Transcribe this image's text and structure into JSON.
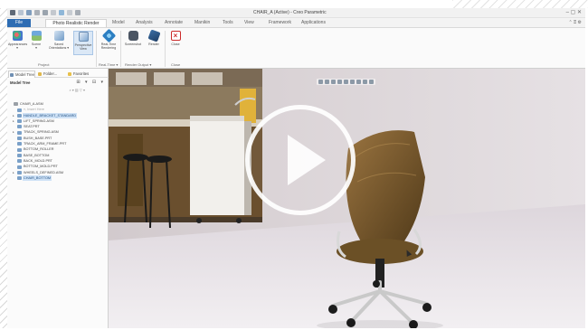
{
  "window": {
    "title": "CHAIR_A (Active) - Creo Parametric",
    "controls": "– ▢ ✕",
    "quick_access_icons": [
      "new-icon",
      "open-icon",
      "save-icon",
      "undo-icon",
      "redo-icon",
      "regenerate-icon",
      "windows-icon",
      "close-window-icon",
      "customize-icon"
    ]
  },
  "ribbon": {
    "tabs": {
      "file": "File",
      "active": "Photo Realistic Render",
      "model": "Model",
      "analysis": "Analysis",
      "annotate": "Annotate",
      "manikin": "Manikin",
      "tools": "Tools",
      "view": "View",
      "framework": "Framework",
      "applications": "Applications"
    },
    "right_tools": "⌃ ⍰ ⚙",
    "buttons": {
      "appearances": "Appearances\n▾",
      "scene": "Scene\n▾",
      "saved_orientations": "Saved\nOrientations ▾",
      "perspective_view": "Perspective\nView",
      "real_time_rendering": "Real-Time\nRendering",
      "screenshot": "Screenshot",
      "render": "Render",
      "close": "Close"
    },
    "groups": {
      "project": "Project",
      "real_time": "Real-Time ▾",
      "render_output": "Render Output ▾",
      "close": "Close"
    },
    "colors": {
      "file_tab": "#2d6cb3",
      "selected_button": "#dbe8f6"
    }
  },
  "panel": {
    "tabs": {
      "model_tree": "Model Tree",
      "folder_browser": "Folder...",
      "favorites": "Favorites"
    },
    "title": "Model Tree",
    "tool_icons": "⊞ ▾ ⊟ ▾",
    "search_placeholder": "⌕ ▾ ▨ ▽ ▾",
    "tree": [
      {
        "label": "CHAIR_A.ASM",
        "root": true,
        "level": 0
      },
      {
        "label": "», Insert Here",
        "dim": true,
        "level": 1
      },
      {
        "label": "HANDLE_BRACKET_STANDARD",
        "highlight": true,
        "level": 1,
        "expand": "▸"
      },
      {
        "label": "LIFT_SPRING.ASM",
        "level": 1,
        "expand": "▸"
      },
      {
        "label": "SEAT.PRT",
        "level": 1
      },
      {
        "label": "TRACK_SPRING.ASM",
        "level": 1,
        "expand": "▸"
      },
      {
        "label": "BUSH_BASE.PRT",
        "level": 1
      },
      {
        "label": "TRACK_ARM_FRAME.PRT",
        "level": 1
      },
      {
        "label": "BOTTOM_ROLLER",
        "level": 1
      },
      {
        "label": "BASE_BOTTOM",
        "level": 1
      },
      {
        "label": "BACK_MOLD.PRT",
        "level": 1
      },
      {
        "label": "BOTTOM_MOLD.PRT",
        "level": 1
      },
      {
        "label": "WHEELS_DEFINED.ASM",
        "level": 1,
        "expand": "▸"
      },
      {
        "label": "CHAIR_BOTTOM",
        "highlight": true,
        "level": 1
      }
    ]
  },
  "viewport": {
    "toolbar_icons": [
      "refit-icon",
      "zoom-in-icon",
      "zoom-out-icon",
      "repaint-icon",
      "display-style-icon",
      "saved-views-icon",
      "datum-display-icon",
      "spin-center-icon",
      "annotation-display-icon"
    ],
    "play_button_icon": "play-icon",
    "colors": {
      "play_ring": "#ffffff",
      "floor": "#ebe6ea",
      "wall": "#dcd6da"
    }
  }
}
